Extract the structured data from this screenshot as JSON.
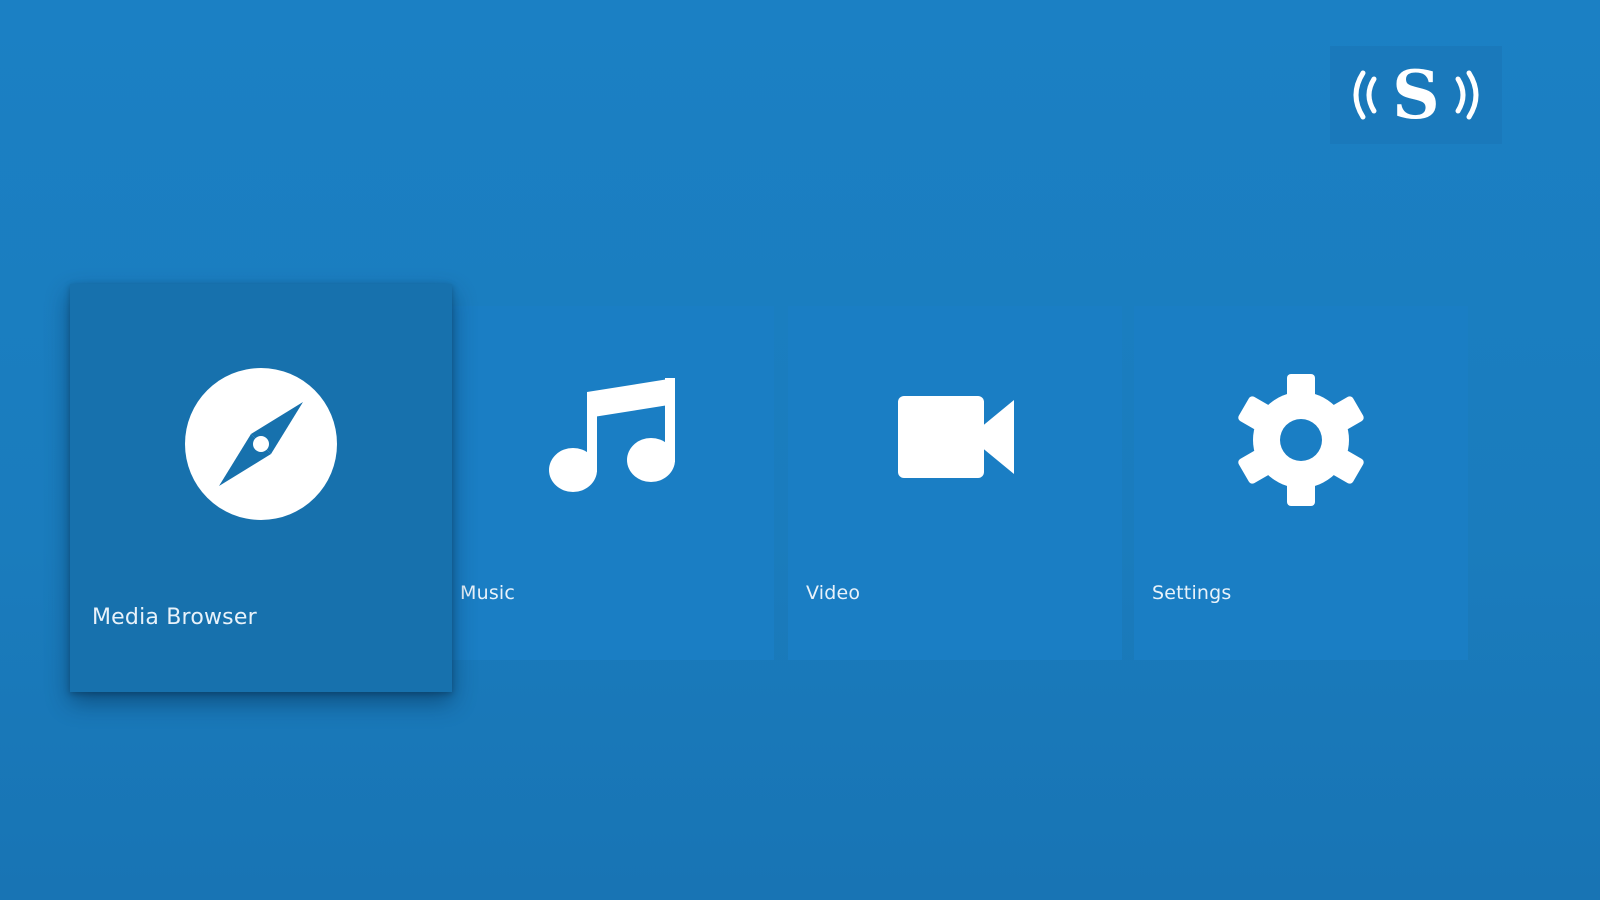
{
  "logo": {
    "letter": "S",
    "icon": "broadcast-s-logo-icon"
  },
  "tiles": [
    {
      "label": "Media Browser",
      "icon": "compass-icon",
      "focused": true
    },
    {
      "label": "Music",
      "icon": "music-note-icon",
      "focused": false
    },
    {
      "label": "Video",
      "icon": "video-camera-icon",
      "focused": false
    },
    {
      "label": "Settings",
      "icon": "gear-icon",
      "focused": false
    }
  ],
  "colors": {
    "background": "#1a7cbd",
    "tile": "#1a7ec4",
    "tile_focused": "#1771ad",
    "icon": "#ffffff"
  }
}
